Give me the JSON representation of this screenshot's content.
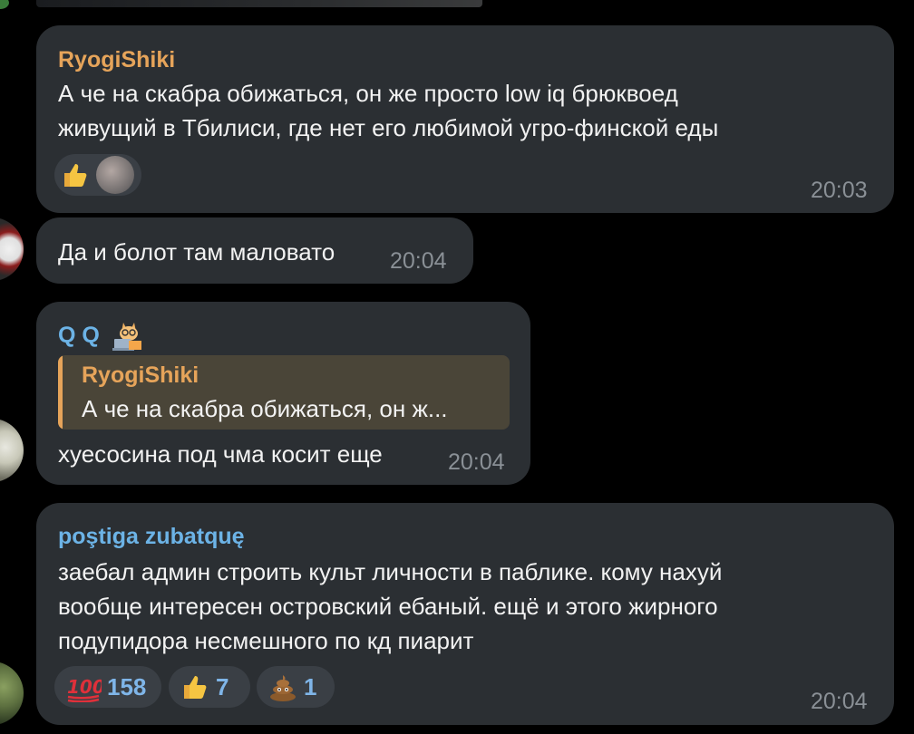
{
  "messages": [
    {
      "sender": "RyogiShiki",
      "sender_color": "#e6a45a",
      "lines": [
        "А че на скабра обижаться, он же просто low iq брюквоед",
        "живущий в Тбилиси, где нет его любимой угро-финской еды"
      ],
      "time": "20:03",
      "reactions": [
        {
          "icon": "thumbs-up-icon"
        },
        {
          "icon": "user-avatar-reaction"
        }
      ]
    },
    {
      "lines": [
        "Да и болот там маловато"
      ],
      "time": "20:04"
    },
    {
      "sender": "Q Q",
      "sender_color": "#6cb3e6",
      "sender_emoji": "cat-laptop-emoji-icon",
      "reply": {
        "sender": "RyogiShiki",
        "text": "А че на скабра обижаться, он ж..."
      },
      "lines": [
        "хуесосина под чма косит еще"
      ],
      "time": "20:04"
    },
    {
      "sender": "poştiga zubatquę",
      "sender_color": "#6cb3e6",
      "lines": [
        "заебал админ строить культ личности в паблике. кому нахуй",
        "вообще интересен островский ебаный. ещё и этого жирного",
        "подупидора несмешного по кд пиарит"
      ],
      "time": "20:04",
      "reactions": [
        {
          "icon": "hundred-points-icon",
          "count": "158"
        },
        {
          "icon": "thumbs-up-icon",
          "count": "7"
        },
        {
          "icon": "pile-of-poo-icon",
          "count": "1"
        }
      ]
    }
  ]
}
